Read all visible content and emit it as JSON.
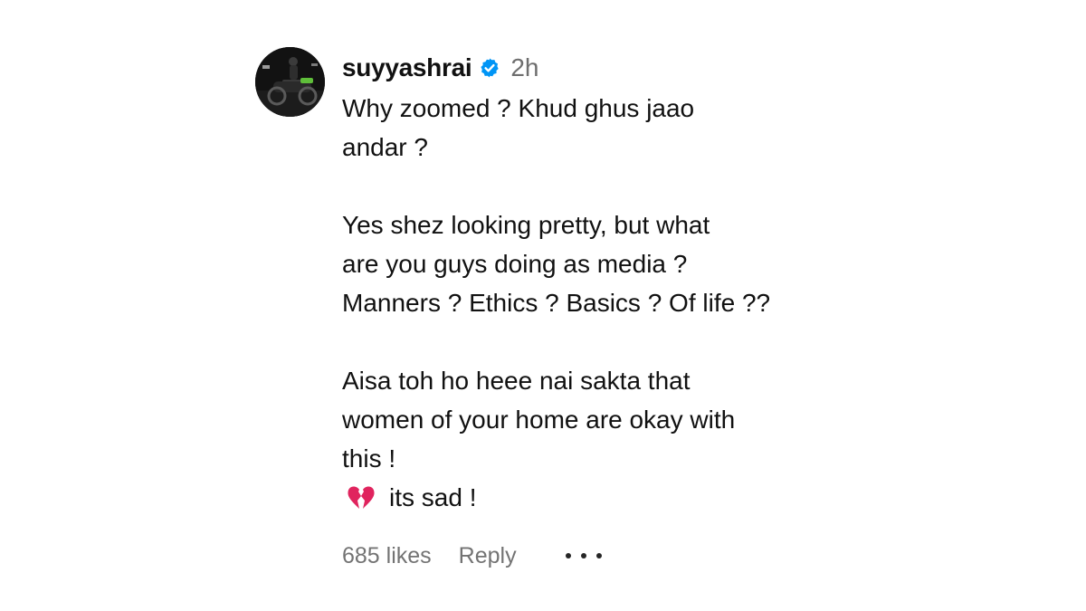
{
  "comment": {
    "author": {
      "username": "suyyashrai",
      "avatar_icon": "profile-photo-avatar",
      "verified_icon": "verified-badge-icon",
      "verified_color": "#0095f6"
    },
    "time_ago": "2h",
    "lines": [
      "Why zoomed ? Khud ghus jaao",
      "andar ?",
      "",
      "Yes shez looking pretty, but what",
      "are you guys doing as media ?",
      "Manners ? Ethics ? Basics ? Of life ??",
      "",
      "Aisa toh ho heee nai sakta that",
      "women of your home are okay with",
      "this !"
    ],
    "last_line": {
      "emoji_icon": "broken-heart-icon",
      "emoji_color": "#e0245e",
      "text": "its sad !"
    },
    "likes_label": "685 likes",
    "reply_label": "Reply",
    "more_icon": "more-options-icon"
  }
}
